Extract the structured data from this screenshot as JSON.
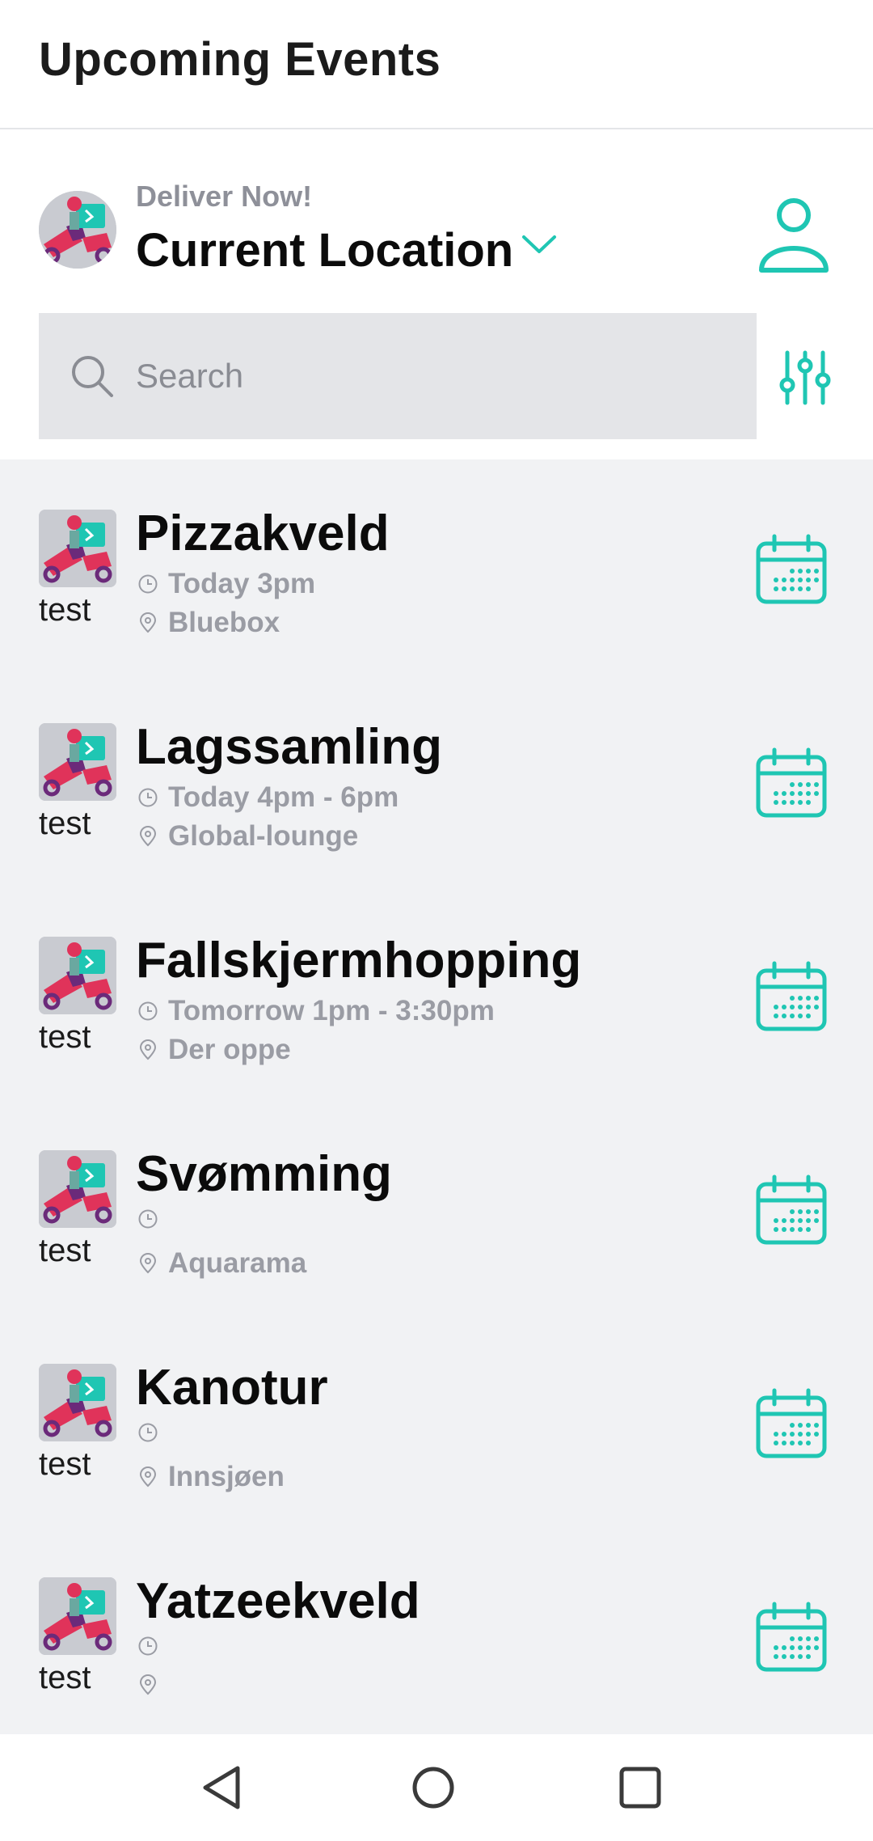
{
  "app": {
    "title": "Upcoming Events"
  },
  "colors": {
    "accent": "#1fc6b3",
    "muted": "#9a9ca4",
    "search_bg": "#e4e5e8"
  },
  "header": {
    "deliver_label": "Deliver Now!",
    "location": "Current Location",
    "location_icon": "chevron-down-icon",
    "profile_icon": "user-icon"
  },
  "search": {
    "placeholder": "Search",
    "value": "",
    "filter_icon": "sliders-icon"
  },
  "events": [
    {
      "name": "Pizzakveld",
      "tag": "test",
      "time": "Today 3pm",
      "location": "Bluebox"
    },
    {
      "name": "Lagssamling",
      "tag": "test",
      "time": "Today 4pm - 6pm",
      "location": "Global-lounge"
    },
    {
      "name": "Fallskjermhopping",
      "tag": "test",
      "time": "Tomorrow 1pm - 3:30pm",
      "location": "Der oppe"
    },
    {
      "name": "Svømming",
      "tag": "test",
      "time": "",
      "location": "Aquarama"
    },
    {
      "name": "Kanotur",
      "tag": "test",
      "time": "",
      "location": "Innsjøen"
    },
    {
      "name": "Yatzeekveld",
      "tag": "test",
      "time": "",
      "location": ""
    }
  ],
  "navbar": {
    "items": [
      "back-icon",
      "home-icon",
      "recents-icon"
    ]
  }
}
